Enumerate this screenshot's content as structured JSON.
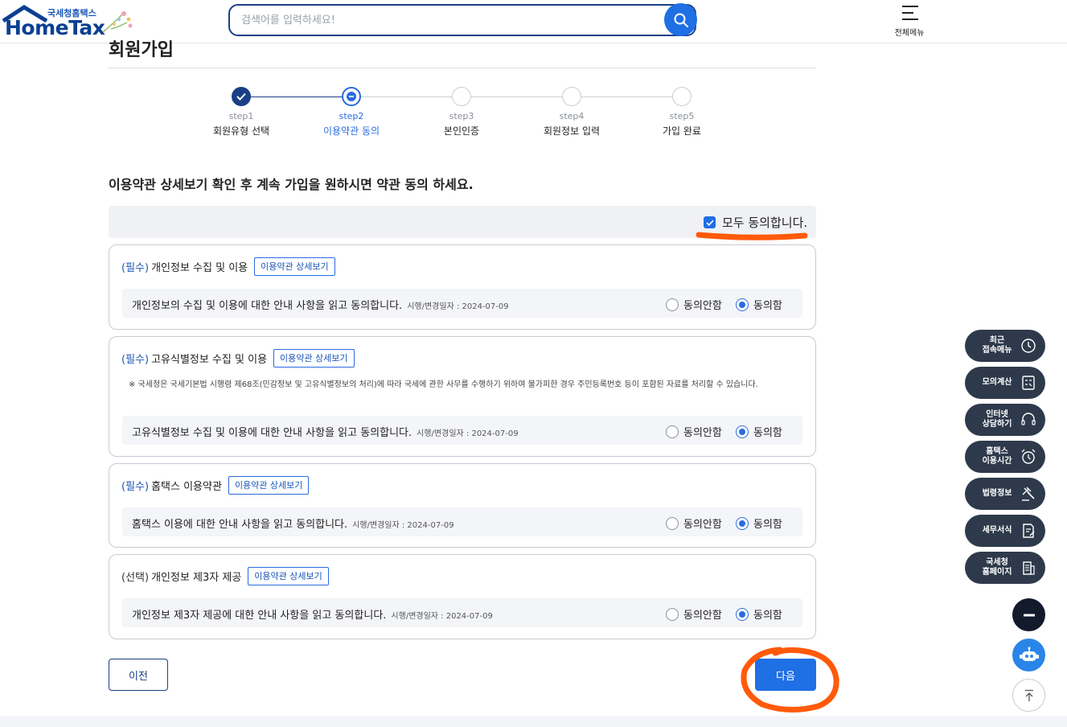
{
  "header": {
    "logo_sub": "국세청홈택스",
    "logo_main": "HomeTax",
    "search_placeholder": "검색어를 입력하세요!",
    "menu_label": "전체메뉴"
  },
  "page": {
    "title": "회원가입",
    "instruction": "이용약관 상세보기 확인 후 계속 가입을 원하시면 약관 동의 하세요."
  },
  "steps": [
    {
      "num": "step1",
      "name": "회원유형 선택",
      "state": "done"
    },
    {
      "num": "step2",
      "name": "이용약관 동의",
      "state": "current"
    },
    {
      "num": "step3",
      "name": "본인인증",
      "state": "todo"
    },
    {
      "num": "step4",
      "name": "회원정보 입력",
      "state": "todo"
    },
    {
      "num": "step5",
      "name": "가입 완료",
      "state": "todo"
    }
  ],
  "agree_all": {
    "label": "모두 동의합니다.",
    "checked": true
  },
  "terms": [
    {
      "tag": "(필수)",
      "title": "개인정보 수집 및 이용",
      "detail_label": "이용약관 상세보기",
      "note": "",
      "agree_text": "개인정보의 수집 및 이용에 대한 안내 사항을 읽고 동의합니다.",
      "date": "시행/변경일자 : 2024-07-09",
      "disagree_label": "동의안함",
      "agree_label": "동의함",
      "selected": "agree"
    },
    {
      "tag": "(필수)",
      "title": "고유식별정보 수집 및 이용",
      "detail_label": "이용약관 상세보기",
      "note": "※ 국세청은 국세기본법 시행령 제68조(민감정보 및 고유식별정보의 처리)에 따라 국세에 관한 사무를 수행하기 위하여 불가피한 경우 주민등록번호 등이 포함된 자료를 처리할 수 있습니다.",
      "agree_text": "고유식별정보 수집 및 이용에 대한 안내 사항을 읽고 동의합니다.",
      "date": "시행/변경일자 : 2024-07-09",
      "disagree_label": "동의안함",
      "agree_label": "동의함",
      "selected": "agree"
    },
    {
      "tag": "(필수)",
      "title": "홈택스 이용약관",
      "detail_label": "이용약관 상세보기",
      "note": "",
      "agree_text": "홈택스 이용에 대한 안내 사항을 읽고 동의합니다.",
      "date": "시행/변경일자 : 2024-07-09",
      "disagree_label": "동의안함",
      "agree_label": "동의함",
      "selected": "agree"
    },
    {
      "tag": "(선택)",
      "title": "개인정보 제3자 제공",
      "detail_label": "이용약관 상세보기",
      "note": "",
      "agree_text": "개인정보 제3자 제공에 대한 안내 사항을 읽고 동의합니다.",
      "date": "시행/변경일자 : 2024-07-09",
      "disagree_label": "동의안함",
      "agree_label": "동의함",
      "selected": "agree"
    }
  ],
  "buttons": {
    "prev": "이전",
    "next": "다음"
  },
  "side_menu": [
    {
      "label": "최근\n접속메뉴",
      "icon": "clock-icon"
    },
    {
      "label": "모의계산",
      "icon": "calculator-icon"
    },
    {
      "label": "인터넷\n상담하기",
      "icon": "headset-icon"
    },
    {
      "label": "홈택스\n이용시간",
      "icon": "alarm-clock-icon"
    },
    {
      "label": "법령정보",
      "icon": "gavel-icon"
    },
    {
      "label": "세무서식",
      "icon": "document-edit-icon"
    },
    {
      "label": "국세청\n홈페이지",
      "icon": "building-icon"
    }
  ],
  "colors": {
    "primary": "#1f6fe5",
    "navy": "#1a3f86",
    "annotation": "#ff5a0a",
    "side_bg": "#2e3a4b"
  }
}
